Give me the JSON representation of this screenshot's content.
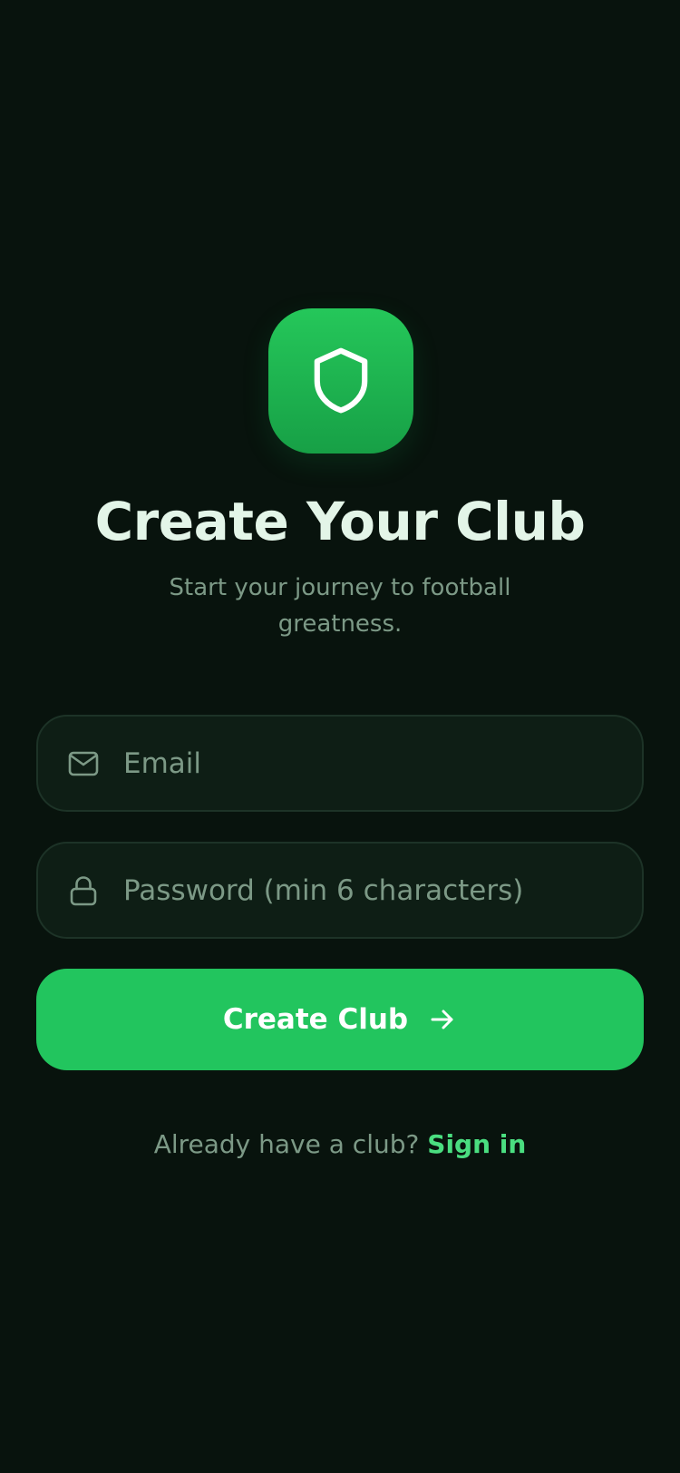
{
  "header": {
    "logo_icon": "shield-icon",
    "title": "Create Your Club",
    "subtitle": "Start your journey to football greatness."
  },
  "form": {
    "email": {
      "icon": "mail-icon",
      "value": "",
      "placeholder": "Email"
    },
    "password": {
      "icon": "lock-icon",
      "value": "",
      "placeholder": "Password (min 6 characters)"
    },
    "submit": {
      "label": "Create Club",
      "icon": "arrow-right-icon"
    }
  },
  "footer": {
    "prompt": "Already have a club?",
    "link_label": "Sign in"
  },
  "colors": {
    "background": "#08130d",
    "accent": "#22c55e",
    "link": "#4ade80",
    "field_background": "#0e1e15",
    "field_border": "#1d3327",
    "title": "#e3f5e8",
    "muted_text": "#7c9986"
  }
}
